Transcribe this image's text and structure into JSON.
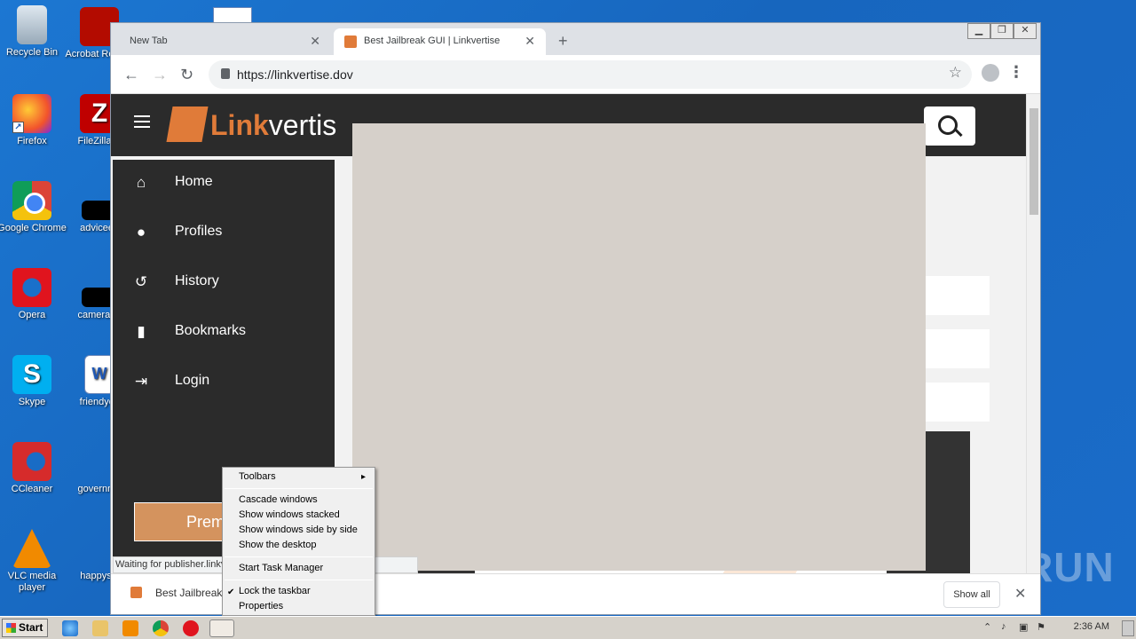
{
  "desktop": {
    "icons": [
      {
        "label": "Recycle Bin"
      },
      {
        "label": "Acrobat Reader"
      },
      {
        "label": "Firefox"
      },
      {
        "label": "FileZilla C"
      },
      {
        "label": "Google Chrome"
      },
      {
        "label": "adviceeff"
      },
      {
        "label": "Opera"
      },
      {
        "label": "camerapa"
      },
      {
        "label": "Skype"
      },
      {
        "label": "friendyes"
      },
      {
        "label": "CCleaner"
      },
      {
        "label": "governme"
      },
      {
        "label": "VLC media player"
      },
      {
        "label": "happysw"
      }
    ]
  },
  "browser": {
    "tabs": [
      {
        "title": "New Tab"
      },
      {
        "title": "Best Jailbreak GUI | Linkvertise"
      }
    ],
    "new_tab_symbol": "+",
    "close_symbol": "✕",
    "url": "https://linkvertise.dov",
    "status_text": "Waiting for publisher.linkv",
    "download": {
      "filename": "Best Jailbreak",
      "show_all_label": "Show all"
    }
  },
  "page": {
    "logo_text_a": "Link",
    "logo_text_b": "vertis",
    "nav": [
      {
        "label": "Home",
        "icon": "home-icon"
      },
      {
        "label": "Profiles",
        "icon": "person-icon"
      },
      {
        "label": "History",
        "icon": "history-icon"
      },
      {
        "label": "Bookmarks",
        "icon": "bookmark-icon"
      },
      {
        "label": "Login",
        "icon": "login-icon"
      }
    ],
    "premium_label": "Prem"
  },
  "context_menu": {
    "toolbars": "Toolbars",
    "cascade": "Cascade windows",
    "stacked": "Show windows stacked",
    "side_by_side": "Show windows side by side",
    "show_desktop": "Show the desktop",
    "task_manager": "Start Task Manager",
    "lock_taskbar": "Lock the taskbar",
    "properties": "Properties"
  },
  "watermark": "ANY RUN",
  "taskbar": {
    "start_label": "Start",
    "clock": "2:36 AM"
  },
  "colors": {
    "accent": "#e07b39",
    "header_bg": "#2b2b2b",
    "overlay": "#d6d0ca"
  }
}
